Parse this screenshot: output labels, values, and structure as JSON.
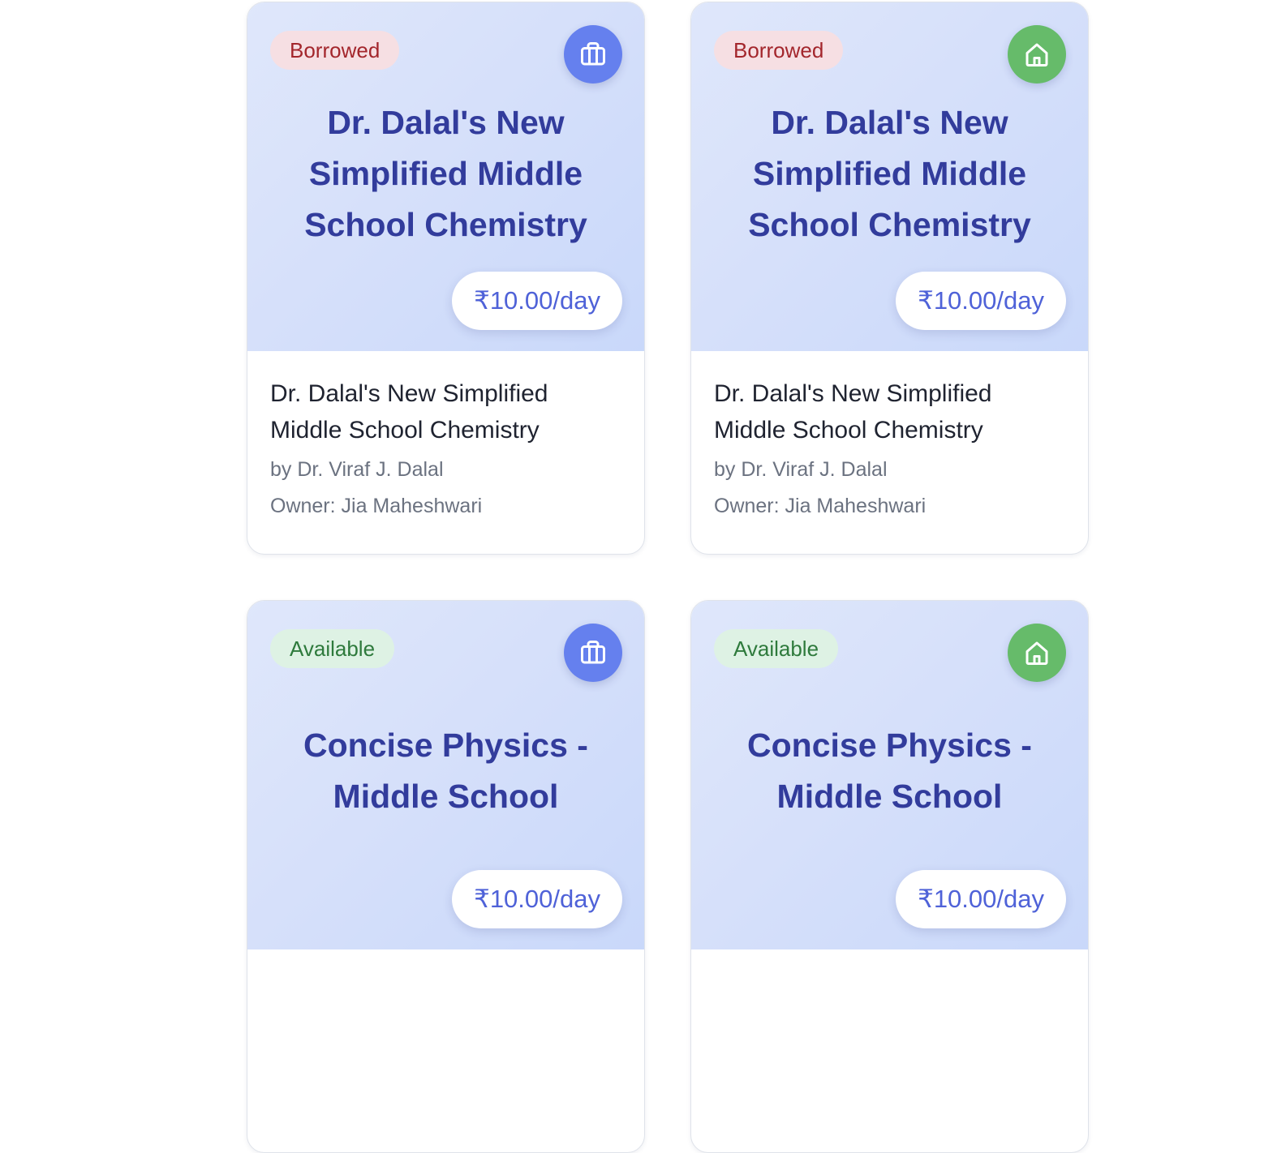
{
  "books": [
    {
      "status": "Borrowed",
      "status_kind": "borrowed",
      "type_icon": "briefcase-icon",
      "cover_title": "Dr. Dalal's New Simplified Middle School Chemistry",
      "price": "₹10.00/day",
      "title": "Dr. Dalal's New Simplified Middle School Chemistry",
      "author": "by Dr. Viraf J. Dalal",
      "owner": "Owner: Jia Maheshwari"
    },
    {
      "status": "Borrowed",
      "status_kind": "borrowed",
      "type_icon": "home-icon",
      "cover_title": "Dr. Dalal's New Simplified Middle School Chemistry",
      "price": "₹10.00/day",
      "title": "Dr. Dalal's New Simplified Middle School Chemistry",
      "author": "by Dr. Viraf J. Dalal",
      "owner": "Owner: Jia Maheshwari"
    },
    {
      "status": "Available",
      "status_kind": "available",
      "type_icon": "briefcase-icon",
      "cover_title": "Concise Physics - Middle School",
      "price": "₹10.00/day"
    },
    {
      "status": "Available",
      "status_kind": "available",
      "type_icon": "home-icon",
      "cover_title": "Concise Physics - Middle School",
      "price": "₹10.00/day"
    }
  ],
  "colors": {
    "borrowed_badge_text": "#a3262c",
    "available_badge_text": "#2e7a3c",
    "school_icon_bg": "#6580ee",
    "home_icon_bg": "#66bb6a",
    "title_blue": "#323c9c",
    "price_blue": "#4f62d8"
  }
}
